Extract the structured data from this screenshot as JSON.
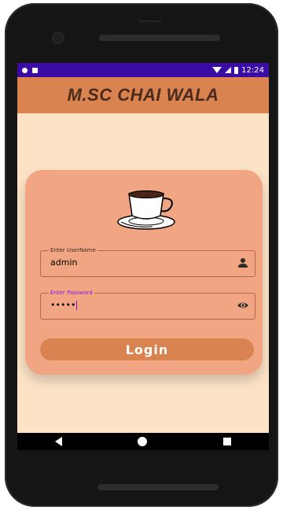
{
  "status": {
    "time": "12:24",
    "left_icons": [
      "record-icon",
      "sd-card-icon"
    ],
    "right_icons": [
      "wifi-icon",
      "signal-icon",
      "battery-icon"
    ]
  },
  "app": {
    "title": "M.SC CHAI WALA",
    "brand_color": "#D98350",
    "status_color": "#3a0ca3",
    "background": "#FCE3C6",
    "card_color": "#F2A582"
  },
  "form": {
    "username": {
      "label": "Enter UserName",
      "value": "admin",
      "icon": "person-icon"
    },
    "password": {
      "label": "Enter Password",
      "value": "•••••",
      "icon": "eye-icon"
    },
    "login_label": "Login"
  },
  "nav": {
    "icons": [
      "back-icon",
      "home-icon",
      "recents-icon"
    ]
  }
}
